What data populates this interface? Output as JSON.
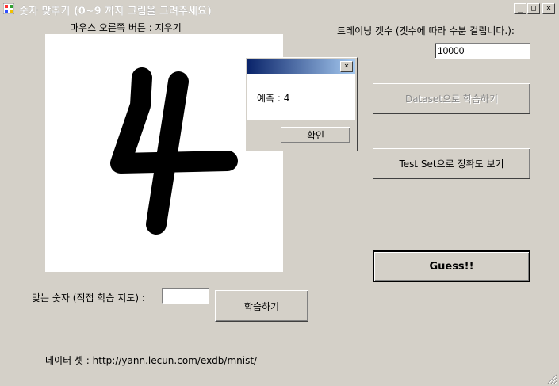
{
  "window": {
    "title": "숫자 맞추기 (0~9 까지 그림을 그려주세요)",
    "minimize_glyph": "_",
    "maximize_glyph": "□",
    "close_glyph": "×"
  },
  "canvas": {
    "hint_label": "마우스 오른쪽 버튼 : 지우기",
    "drawn_digit": "4"
  },
  "training": {
    "count_label": "트레이닝 갯수 (갯수에 따라 수분 걸립니다.):",
    "count_value": "10000",
    "dataset_button": "Dataset으로 학습하기",
    "testset_button": "Test Set으로 정확도 보기",
    "guess_button": "Guess!!"
  },
  "supervise": {
    "label": "맞는 숫자 (직접 학습 지도) :",
    "value": "",
    "learn_button": "학습하기"
  },
  "footer": {
    "dataset_text": "데이터 셋 :  http://yann.lecun.com/exdb/mnist/"
  },
  "dialog": {
    "title": "",
    "message": "예측 : 4",
    "ok_button": "확인",
    "close_glyph": "×"
  },
  "colors": {
    "window_bg": "#d4d0c8",
    "dialog_title_start": "#0a246a",
    "dialog_title_end": "#a6caf0",
    "ink": "#000000"
  }
}
